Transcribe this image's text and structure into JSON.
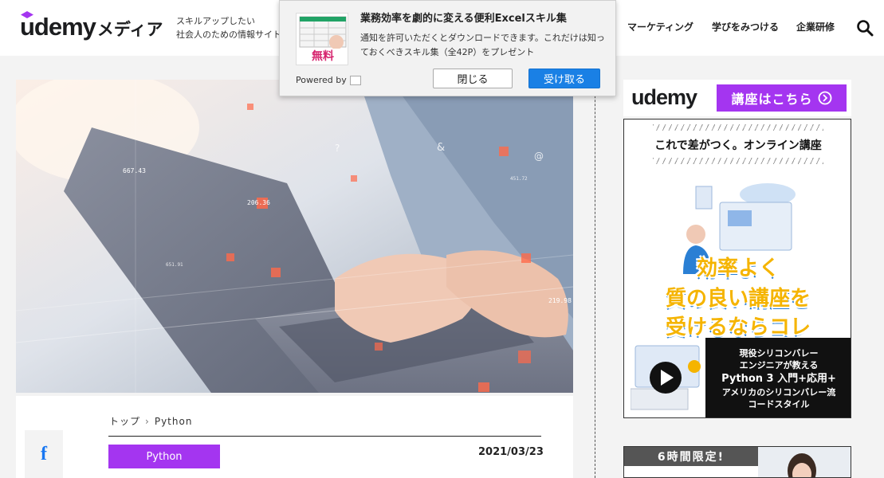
{
  "header": {
    "logo_main": "udemy",
    "logo_sub": "メディア",
    "tagline_line1": "スキルアップしたい",
    "tagline_line2": "社会人のための情報サイト",
    "nav": [
      "マーケティング",
      "学びをみつける",
      "企業研修"
    ],
    "search_icon": "search-icon"
  },
  "popup": {
    "title": "業務効率を劇的に変える便利Excelスキル集",
    "body": "通知を許可いただくとダウンロードできます。これだけは知っておくべきスキル集（全42P）をプレゼント",
    "thumb_label": "無料",
    "powered_by": "Powered by",
    "close_label": "閉じる",
    "accept_label": "受け取る"
  },
  "hero": {
    "overlay_numbers": [
      "667.43",
      "206.36",
      "219.98",
      "451.72",
      "651.91"
    ]
  },
  "article": {
    "breadcrumb": [
      "トップ",
      "Python"
    ],
    "category": "Python",
    "date": "2021/03/23",
    "share_icon": "facebook-icon",
    "share_label": "f"
  },
  "sidebar": {
    "banner_logo": "udemy",
    "banner_button": "講座はこちら",
    "ad_headline": "これで差がつく。オンライン講座",
    "ad_line1": "効率よく",
    "ad_line2": "質の良い講座を",
    "ad_line3": "受けるならコレ",
    "ad_dark_line1": "現役シリコンバレー",
    "ad_dark_line2": "エンジニアが教える",
    "ad_dark_line3": "Python 3 入門+応用+",
    "ad_dark_line4": "アメリカのシリコンバレー流",
    "ad_dark_line5": "コードスタイル",
    "ad2_banner": "6時間限定!"
  },
  "colors": {
    "brand_purple": "#a435f0",
    "accept_blue": "#1a80e5",
    "facebook_blue": "#1877f2",
    "ad_yellow": "#f5b400"
  }
}
